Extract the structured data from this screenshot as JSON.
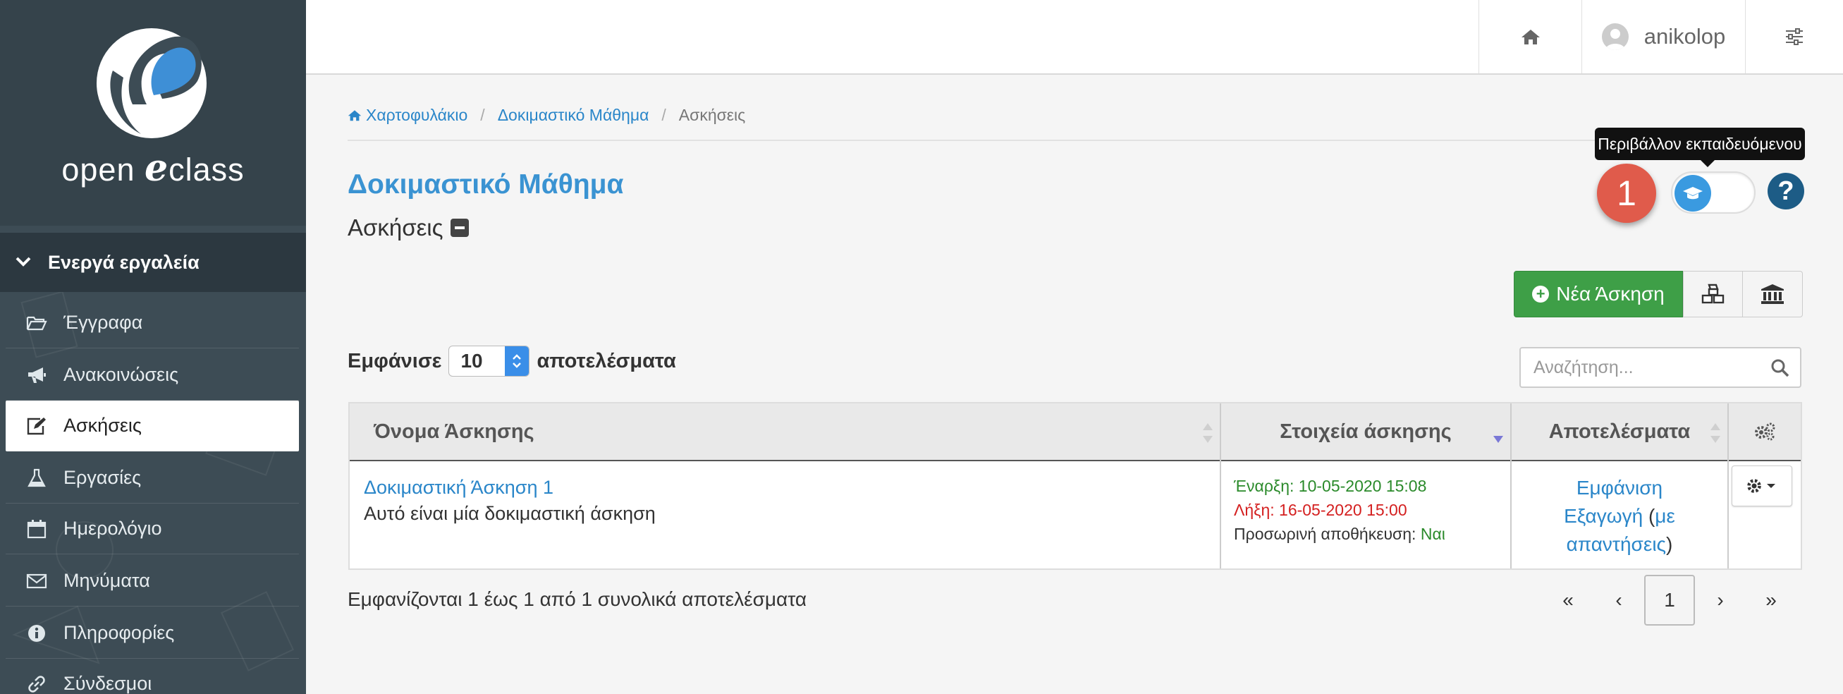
{
  "brand": {
    "logo_text_pre": "open ",
    "logo_text_e": "e",
    "logo_text_post": "class"
  },
  "sidebar": {
    "section_label": "Ενεργά εργαλεία",
    "items": [
      {
        "label": "Έγγραφα",
        "icon": "folder-open-icon"
      },
      {
        "label": "Ανακοινώσεις",
        "icon": "bullhorn-icon"
      },
      {
        "label": "Ασκήσεις",
        "icon": "pencil-square-icon",
        "active": true
      },
      {
        "label": "Εργασίες",
        "icon": "flask-icon"
      },
      {
        "label": "Ημερολόγιο",
        "icon": "calendar-icon"
      },
      {
        "label": "Μηνύματα",
        "icon": "envelope-icon"
      },
      {
        "label": "Πληροφορίες",
        "icon": "info-circle-icon"
      },
      {
        "label": "Σύνδεσμοι",
        "icon": "link-icon"
      }
    ]
  },
  "header": {
    "username": "anikolop"
  },
  "breadcrumb": {
    "home": "Χαρτοφυλάκιο",
    "course": "Δοκιμαστικό Μάθημα",
    "current": "Ασκήσεις"
  },
  "page": {
    "course_title": "Δοκιμαστικό Μάθημα",
    "subtitle": "Ασκήσεις"
  },
  "tooltip": {
    "text": "Περιβάλλον εκπαιδευόμενου"
  },
  "badge": {
    "number": "1",
    "color": "#e05b4b"
  },
  "help": {
    "symbol": "?"
  },
  "actions": {
    "new_label": "Νέα Άσκηση"
  },
  "table_controls": {
    "show_prefix": "Εμφάνισε",
    "page_size": "10",
    "show_suffix": "αποτελέσματα",
    "search_placeholder": "Αναζήτηση..."
  },
  "table": {
    "columns": [
      "Όνομα Άσκησης",
      "Στοιχεία άσκησης",
      "Αποτελέσματα"
    ],
    "rows": [
      {
        "name": "Δοκιμαστική Άσκηση 1",
        "description": "Αυτό είναι μία δοκιμαστική άσκηση",
        "start": "Έναρξη: 10-05-2020 15:08",
        "end": "Λήξη: 16-05-2020 15:00",
        "temp_save_label": "Προσωρινή αποθήκευση:",
        "temp_save_value": "Ναι",
        "results_view": "Εμφάνιση",
        "results_export": "Εξαγωγή",
        "results_with_answers": "με απαντήσεις"
      }
    ]
  },
  "info": {
    "summary": "Εμφανίζονται 1 έως 1 από 1 συνολικά αποτελέσματα"
  },
  "pagination": {
    "first": "«",
    "prev": "‹",
    "current": "1",
    "next": "›",
    "last": "»"
  },
  "colors": {
    "accent": "#3a93d2",
    "green_button": "#3e9f47",
    "sidebar": "#3d4c55"
  }
}
